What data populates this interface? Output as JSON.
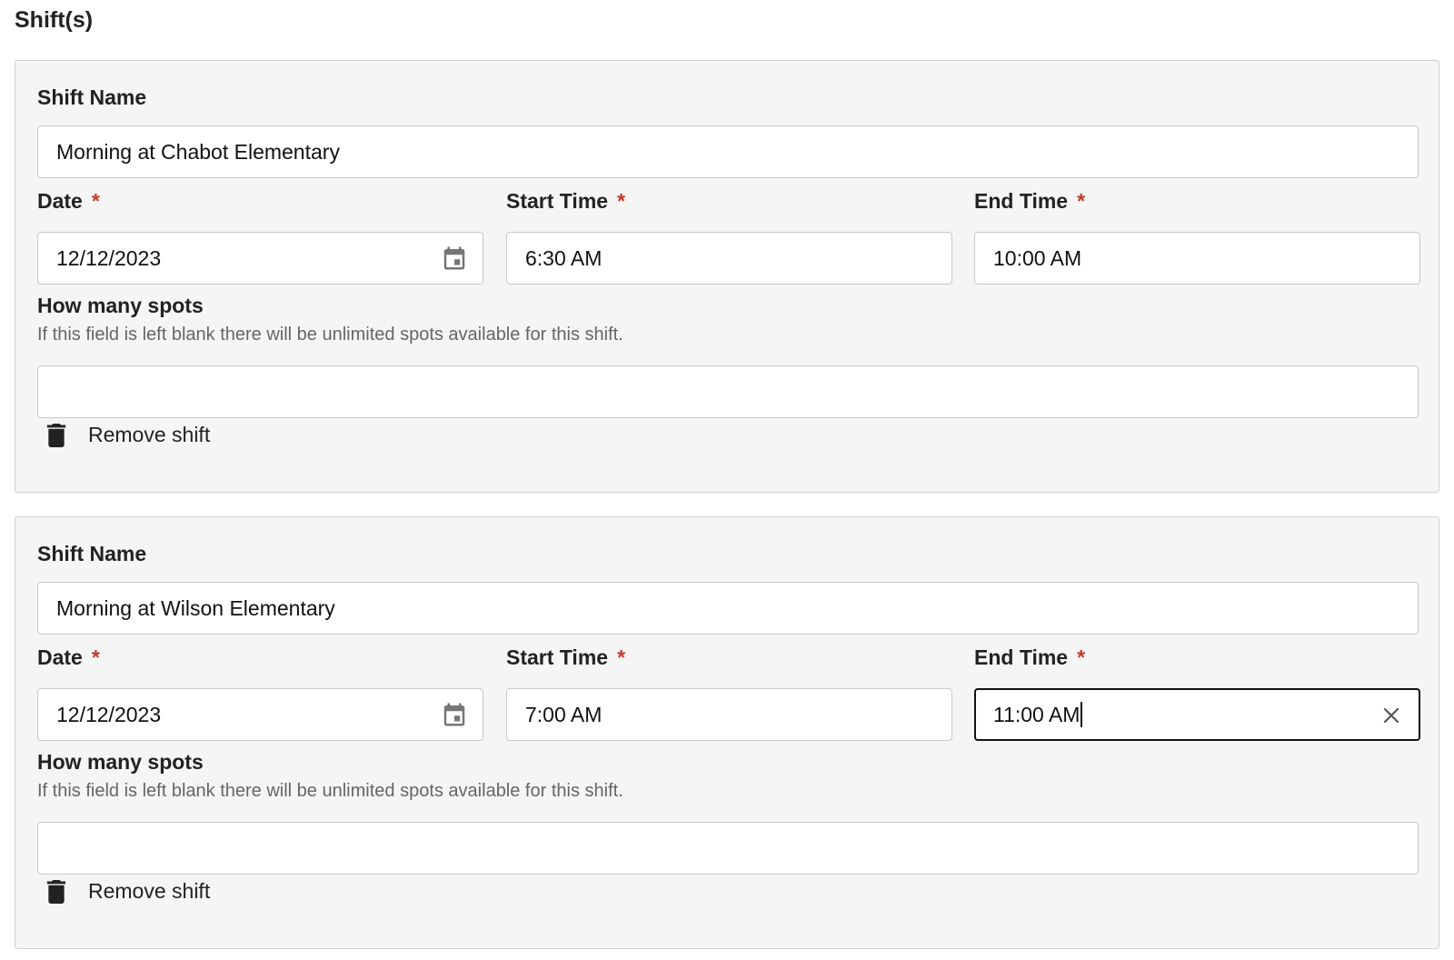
{
  "section_title": "Shift(s)",
  "labels": {
    "shift_name": "Shift Name",
    "date": "Date",
    "start_time": "Start Time",
    "end_time": "End Time",
    "required_marker": "*",
    "spots": "How many spots",
    "spots_hint": "If this field is left blank there will be unlimited spots available for this shift.",
    "remove": "Remove shift"
  },
  "shifts": [
    {
      "name": "Morning at Chabot Elementary",
      "date": "12/12/2023",
      "start_time": "6:30 AM",
      "end_time": "10:00 AM",
      "spots": ""
    },
    {
      "name": "Morning at Wilson Elementary",
      "date": "12/12/2023",
      "start_time": "7:00 AM",
      "end_time": "11:00 AM",
      "spots": ""
    }
  ],
  "icons": {
    "calendar": "calendar-icon",
    "clear": "close-icon",
    "remove": "trash-icon"
  },
  "colors": {
    "required": "#c0392b",
    "card_background": "#f5f5f5",
    "focus_border": "#111111"
  }
}
